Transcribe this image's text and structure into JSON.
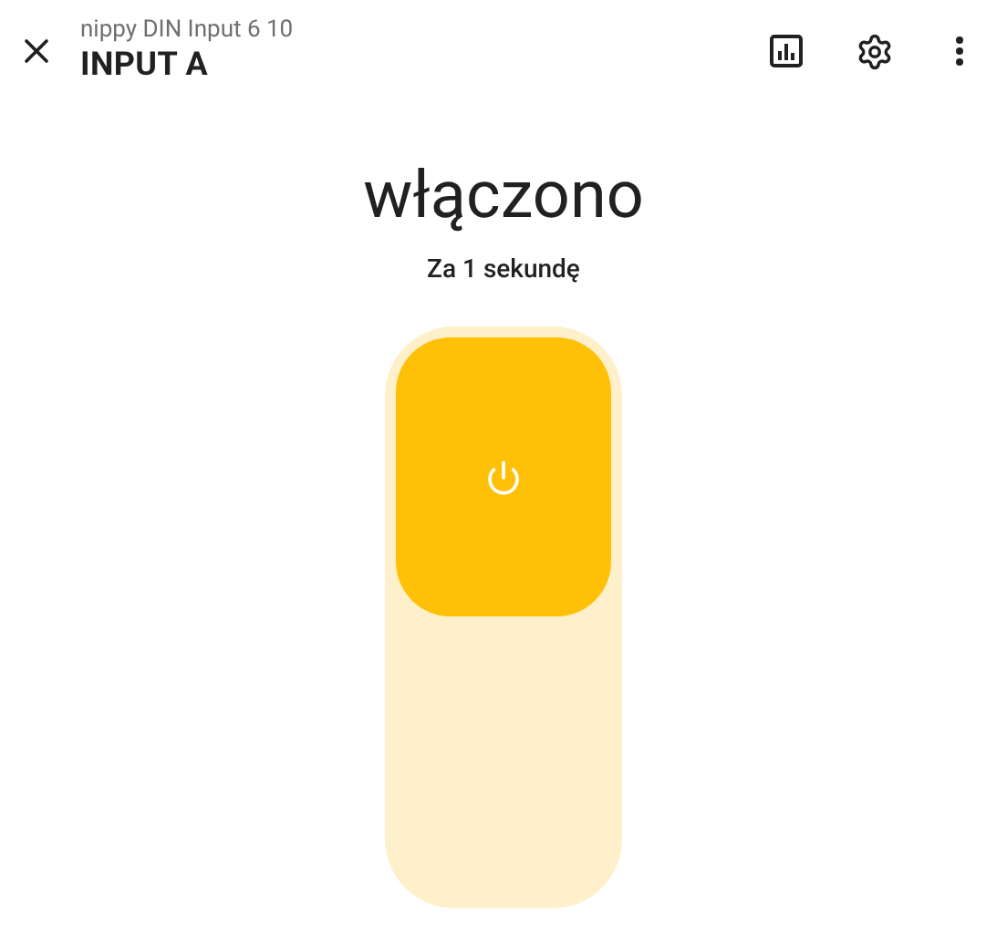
{
  "header": {
    "subtitle": "nippy DIN Input 6 10",
    "title": "INPUT A"
  },
  "state": "włączono",
  "last_changed": "Za 1 sekundę",
  "toggle": {
    "on": true
  }
}
